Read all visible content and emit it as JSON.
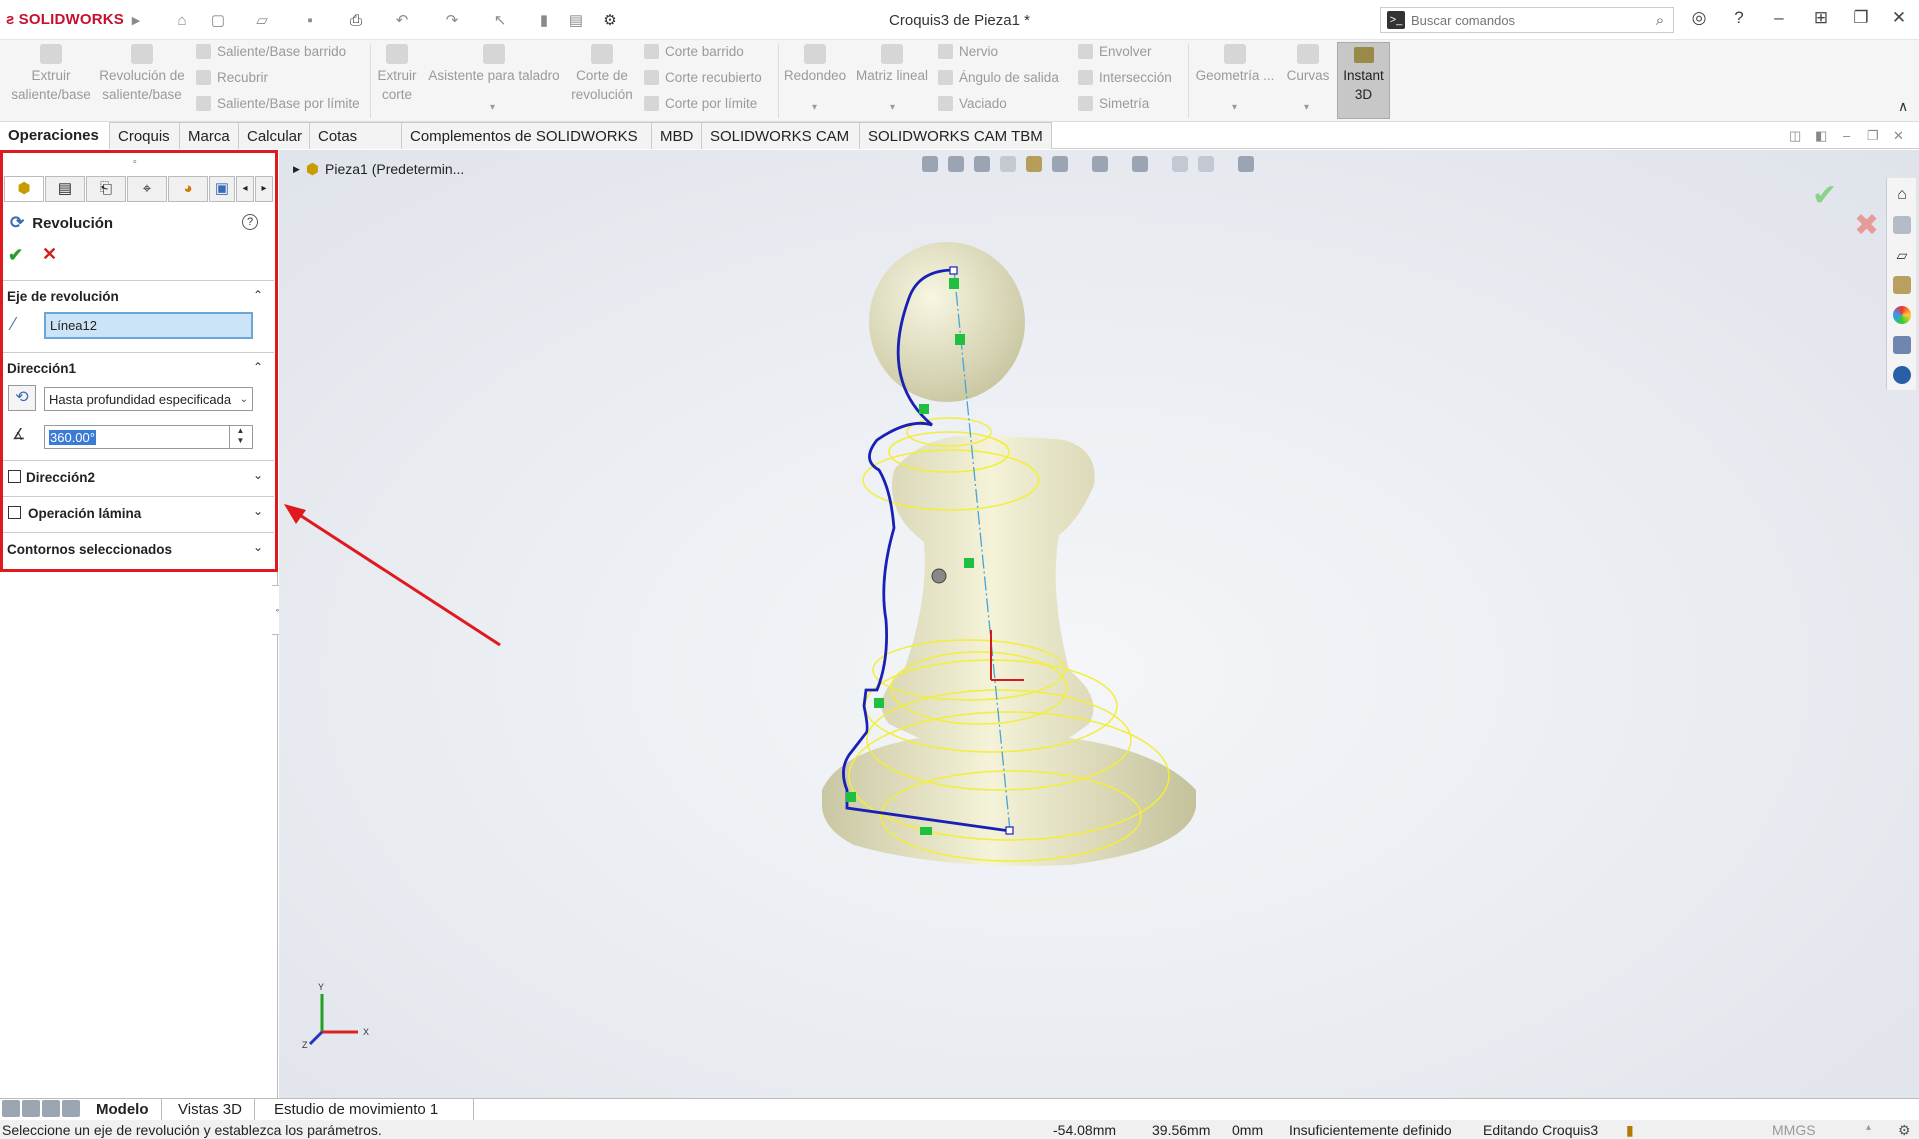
{
  "app": {
    "brand": "SOLIDWORKS",
    "document_title": "Croquis3 de Pieza1 *"
  },
  "search": {
    "placeholder": "Buscar comandos"
  },
  "ribbon": {
    "extrude_boss": "Extruir saliente/base",
    "revolve_boss": "Revolución de saliente/base",
    "swept_boss": "Saliente/Base barrido",
    "loft": "Recubrir",
    "boundary_boss": "Saliente/Base por límite",
    "extruded_cut": "Extruir corte",
    "hole_wizard": "Asistente para taladro",
    "revolved_cut": "Corte de revolución",
    "swept_cut": "Corte barrido",
    "lofted_cut": "Corte recubierto",
    "boundary_cut": "Corte por límite",
    "fillet": "Redondeo",
    "linear_pattern": "Matriz lineal",
    "rib": "Nervio",
    "draft": "Ángulo de salida",
    "shell": "Vaciado",
    "wrap": "Envolver",
    "intersect": "Intersección",
    "mirror": "Simetría",
    "ref_geometry": "Geometría ...",
    "curves": "Curvas",
    "instant3d": "Instant 3D"
  },
  "tabs": [
    "Operaciones",
    "Croquis",
    "Marca",
    "Calcular",
    "Cotas MBD",
    "Complementos de SOLIDWORKS",
    "MBD",
    "SOLIDWORKS CAM",
    "SOLIDWORKS CAM TBM"
  ],
  "panel": {
    "title": "Revolución",
    "help": "?",
    "axis_section": "Eje de revolución",
    "axis_value": "Línea12",
    "direction1_section": "Dirección1",
    "end_condition": "Hasta profundidad especificada",
    "angle": "360.00°",
    "direction2_section": "Dirección2",
    "thin_section": "Operación lámina",
    "contours_section": "Contornos seleccionados"
  },
  "tree": {
    "root": "Pieza1 (Predetermin..."
  },
  "triad": {
    "x": "X",
    "y": "Y",
    "z": "Z"
  },
  "bottom_tabs": [
    "Modelo",
    "Vistas 3D",
    "Estudio de movimiento 1"
  ],
  "status": {
    "message": "Seleccione un eje de revolución y establezca los parámetros.",
    "x": "-54.08mm",
    "y": "39.56mm",
    "z": "0mm",
    "definition": "Insuficientemente definido",
    "editing": "Editando Croquis3",
    "units": "MMGS"
  },
  "colors": {
    "accent_red": "#e0191f",
    "sketch_blue": "#1a1fb5",
    "model_fill": "#e8e6c4",
    "highlight_yellow": "#f2ee3a"
  }
}
